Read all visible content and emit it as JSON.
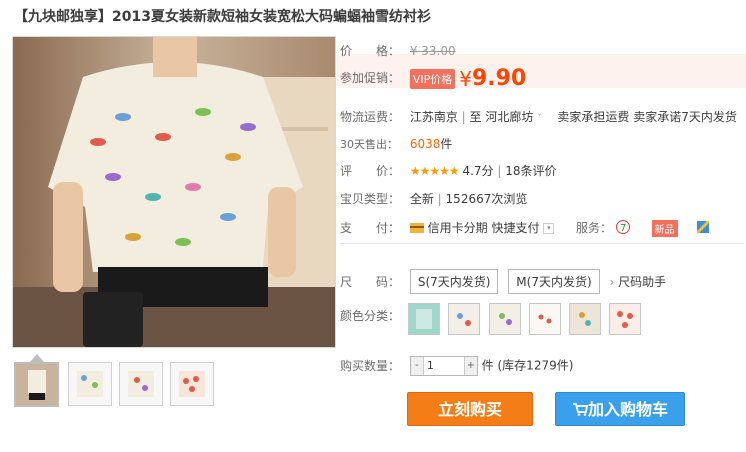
{
  "product": {
    "title": "【九块邮独享】2013夏女装新款短袖女装宽松大码蝙蝠袖雪纺衬衫"
  },
  "price": {
    "label": "价　　格：",
    "original": "¥ 33.00"
  },
  "promo": {
    "label": "参加促销：",
    "badge": "VIP价格",
    "yen": "¥",
    "price": "9.90"
  },
  "shipping": {
    "label": "物流运费：",
    "from": "江苏南京",
    "divider": "|",
    "to_prefix": "至",
    "to": "河北廊坊",
    "fee_text": "卖家承担运费",
    "promise_text": "卖家承诺7天内发货"
  },
  "sales": {
    "label": "30天售出：",
    "count": "6038",
    "unit": "件"
  },
  "rating": {
    "label": "评　　价：",
    "stars": "★★★★★",
    "score": "4.7分",
    "divider": "|",
    "reviews": "18条评价"
  },
  "item_type": {
    "label": "宝贝类型：",
    "condition": "全新",
    "divider": "|",
    "views": "152667次浏览"
  },
  "payment": {
    "label": "支　　付：",
    "credit": "信用卡分期",
    "quick": "快捷支付",
    "service_label": "服务：",
    "new_badge": "新品"
  },
  "sizes": {
    "label": "尺　　码：",
    "options": [
      "S(7天内发货)",
      "M(7天内发货)"
    ],
    "helper": "尺码助手"
  },
  "colors": {
    "label": "颜色分类：",
    "count_note": ""
  },
  "quantity": {
    "label": "购买数量：",
    "minus": "-",
    "value": "1",
    "plus": "+",
    "unit": "件",
    "stock": "(库存1279件)"
  },
  "actions": {
    "buy_now": "立刻购买",
    "add_to_cart": "加入购物车"
  },
  "colors_palette": {
    "promo_red": "#ff4400",
    "buy_orange": "#f47d17",
    "cart_blue": "#3ba0ec"
  }
}
